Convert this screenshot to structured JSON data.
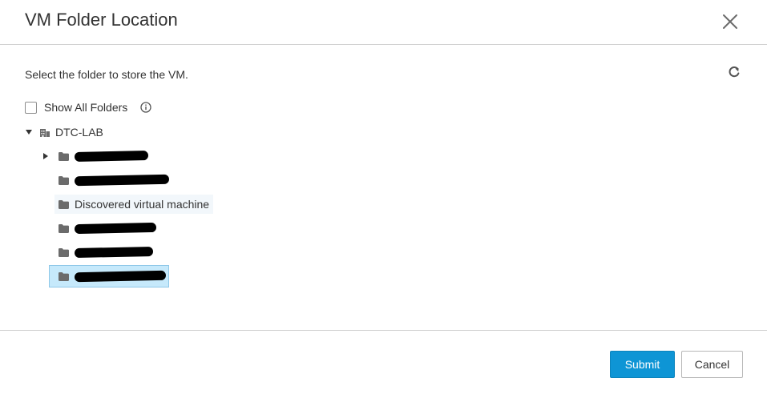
{
  "dialog": {
    "title": "VM Folder Location",
    "instruction": "Select the folder to store the VM.",
    "show_all_folders_label": "Show All Folders",
    "show_all_folders_checked": false
  },
  "tree": {
    "root": {
      "label": "DTC-LAB",
      "expanded": true,
      "icon": "datacenter-icon"
    },
    "children": [
      {
        "label": "",
        "icon": "folder-icon",
        "has_children": true,
        "redacted": true
      },
      {
        "label": "",
        "icon": "folder-icon",
        "has_children": false,
        "redacted": true
      },
      {
        "label": "Discovered virtual machine",
        "icon": "folder-icon",
        "has_children": false,
        "redacted": false
      },
      {
        "label": "",
        "icon": "folder-icon",
        "has_children": false,
        "redacted": true
      },
      {
        "label": "",
        "icon": "folder-icon",
        "has_children": false,
        "redacted": true
      },
      {
        "label": "",
        "icon": "folder-icon",
        "has_children": false,
        "redacted": true,
        "selected": true
      }
    ]
  },
  "footer": {
    "submit_label": "Submit",
    "cancel_label": "Cancel"
  },
  "colors": {
    "primary": "#0e95d5",
    "selected_bg": "#c6e9fb",
    "hover_bg": "#f2f7fb",
    "icon_gray": "#666666",
    "divider": "#cfcfcf"
  }
}
